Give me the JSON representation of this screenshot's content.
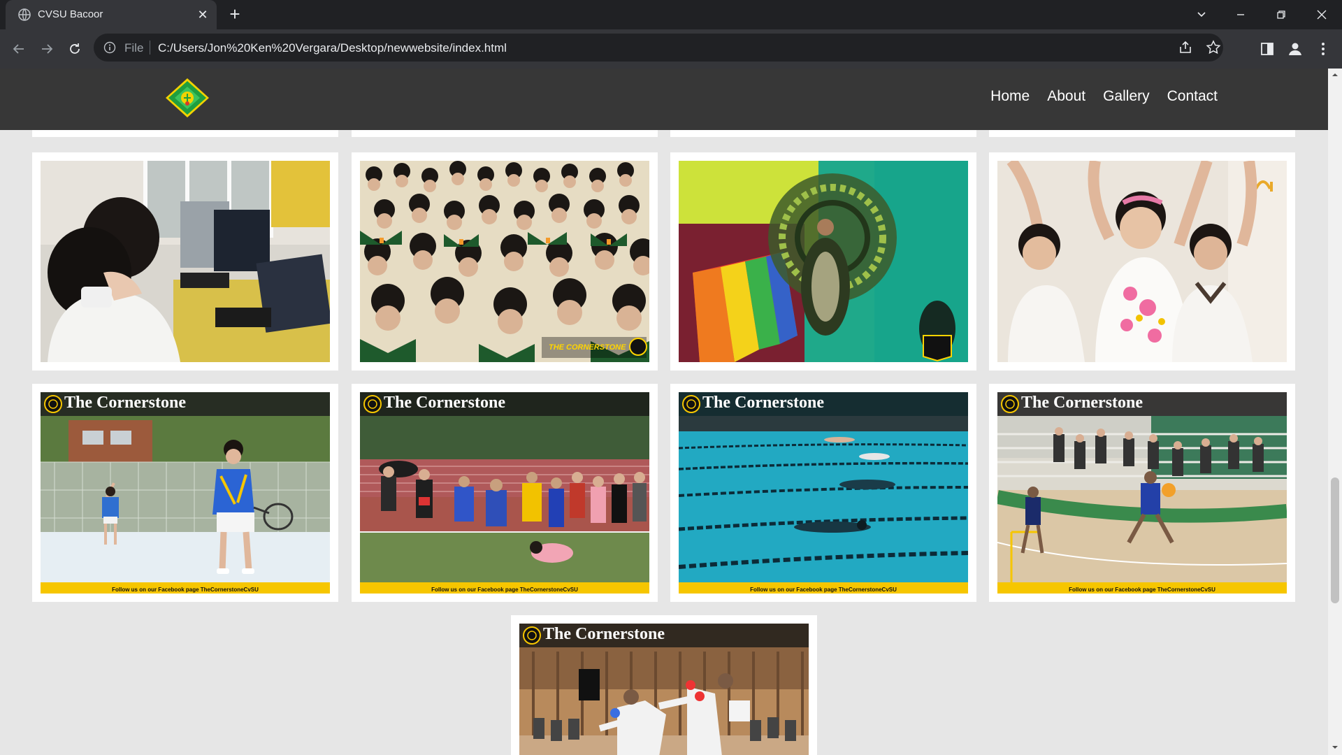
{
  "browser": {
    "tab_title": "CVSU Bacoor",
    "scheme_label": "File",
    "url": "C:/Users/Jon%20Ken%20Vergara/Desktop/newwebsite/index.html"
  },
  "site": {
    "nav": [
      {
        "label": "Home"
      },
      {
        "label": "About"
      },
      {
        "label": "Gallery"
      },
      {
        "label": "Contact"
      }
    ]
  },
  "gallery": {
    "banner_title": "The Cornerstone",
    "footer_text": "Follow us on our Facebook page  TheCornerstoneCvSU",
    "watermark_text": "THE CORNERSTONE"
  },
  "colors": {
    "site_nav_bg": "#373737",
    "page_bg": "#e6e6e6",
    "accent_yellow": "#f6c600",
    "logo_green": "#1f9e3f"
  }
}
